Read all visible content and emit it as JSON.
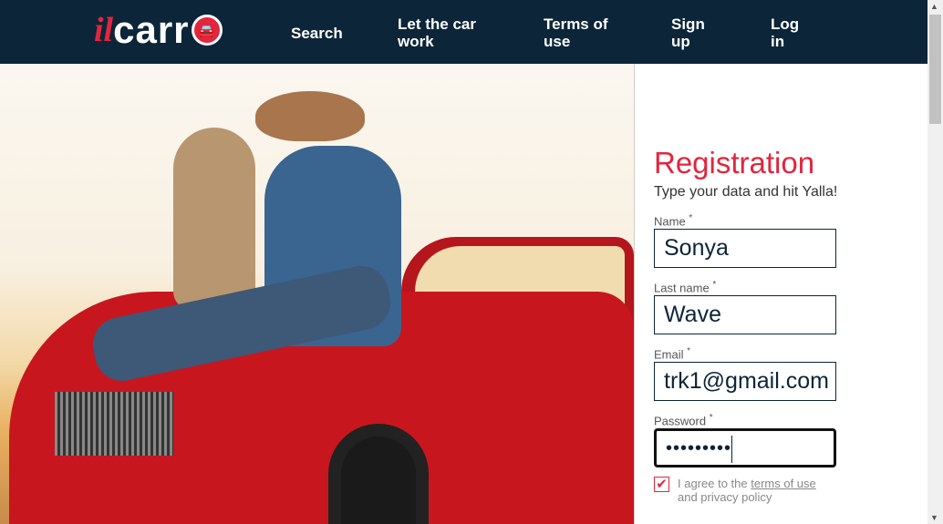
{
  "logo": {
    "il": "il",
    "carr": "carr"
  },
  "nav": {
    "search": "Search",
    "let_car_work": "Let the car work",
    "terms": "Terms of use",
    "signup": "Sign up",
    "login": "Log in"
  },
  "form": {
    "title": "Registration",
    "subtitle": "Type your data and hit Yalla!",
    "name_label": "Name",
    "name_value": "Sonya",
    "lastname_label": "Last name",
    "lastname_value": "Wave",
    "email_label": "Email",
    "email_value": "trk1@gmail.com",
    "password_label": "Password",
    "password_value": "•••••••••",
    "required_mark": "*",
    "agree_text": "I agree to the ",
    "terms_link": "terms of use",
    "agree_text2": "and privacy policy",
    "agree_checked": true
  },
  "colors": {
    "brand": "#e1263d",
    "navbar": "#0c2538"
  }
}
